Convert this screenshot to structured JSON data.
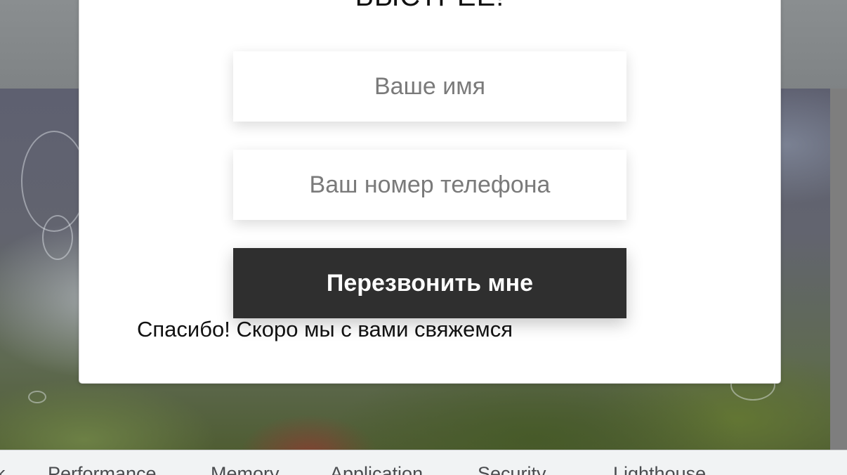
{
  "modal": {
    "title": "БЫСТРЕЕ!",
    "name_placeholder": "Ваше имя",
    "phone_placeholder": "Ваш номер телефона",
    "submit_label": "Перезвонить мне",
    "success_message": "Спасибо! Скоро мы с вами свяжемся"
  },
  "devtools": {
    "tabs": [
      {
        "label": "k"
      },
      {
        "label": "Performance"
      },
      {
        "label": "Memory"
      },
      {
        "label": "Application"
      },
      {
        "label": "Security"
      },
      {
        "label": "Lighthouse"
      }
    ]
  }
}
